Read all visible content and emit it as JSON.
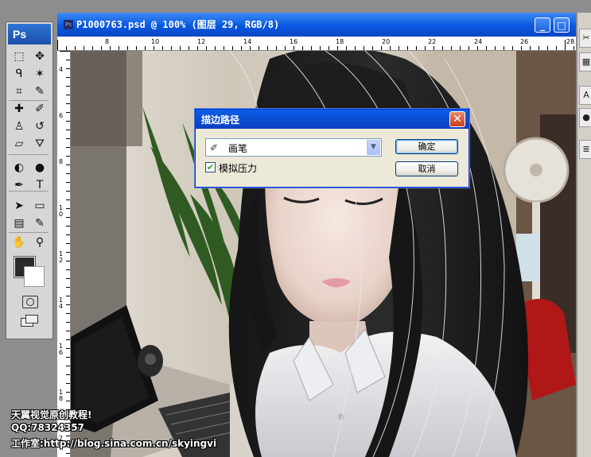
{
  "tools_palette": {
    "logo": "Ps",
    "tools": [
      {
        "name": "marquee-icon",
        "glyph": "⬚"
      },
      {
        "name": "move-icon",
        "glyph": "✥"
      },
      {
        "name": "lasso-icon",
        "glyph": "ᑫ"
      },
      {
        "name": "magic-wand-icon",
        "glyph": "✶"
      },
      {
        "name": "crop-icon",
        "glyph": "⌗"
      },
      {
        "name": "eyedropper-icon",
        "glyph": "✎"
      },
      {
        "name": "healing-brush-icon",
        "glyph": "✚"
      },
      {
        "name": "brush-icon",
        "glyph": "✐"
      },
      {
        "name": "clone-stamp-icon",
        "glyph": "♙"
      },
      {
        "name": "history-brush-icon",
        "glyph": "↺"
      },
      {
        "name": "eraser-icon",
        "glyph": "▱"
      },
      {
        "name": "paint-bucket-icon",
        "glyph": "⛛"
      },
      {
        "name": "blur-icon",
        "glyph": "◐"
      },
      {
        "name": "dodge-icon",
        "glyph": "●"
      },
      {
        "name": "pen-icon",
        "glyph": "✒"
      },
      {
        "name": "type-icon",
        "glyph": "T"
      },
      {
        "name": "path-selection-icon",
        "glyph": "➤"
      },
      {
        "name": "rectangle-shape-icon",
        "glyph": "▭"
      },
      {
        "name": "notes-icon",
        "glyph": "▤"
      },
      {
        "name": "eyedropper2-icon",
        "glyph": "✎"
      },
      {
        "name": "hand-icon",
        "glyph": "✋"
      },
      {
        "name": "zoom-icon",
        "glyph": "⚲"
      }
    ],
    "foreground_color": "#2a2a2a",
    "background_color": "#ffffff"
  },
  "document": {
    "title": "P1000763.psd @ 100% (图层 29, RGB/8)",
    "ruler_top": [
      "8",
      "10",
      "12",
      "14",
      "16",
      "18",
      "20",
      "22",
      "24",
      "26",
      "28"
    ],
    "ruler_left": [
      "4",
      "6",
      "8",
      "1\n0",
      "1\n2",
      "1\n4",
      "1\n6",
      "1\n8",
      "2"
    ],
    "window_buttons": {
      "minimize": "_",
      "maximize": "□"
    }
  },
  "dialog": {
    "title": "描边路径",
    "tool_select_value": "画笔",
    "simulate_pressure_label": "模拟压力",
    "simulate_pressure_checked": true,
    "ok_label": "确定",
    "cancel_label": "取消",
    "close_glyph": "✕"
  },
  "watermark": {
    "line1": "天翼视觉原创教程!",
    "line2": "QQ:78324357",
    "line3": "工作室:http://blog.sina.com.cn/skyingvi"
  },
  "right_panel_icons": [
    {
      "name": "tools-panel-icon",
      "glyph": "✂"
    },
    {
      "name": "navigator-panel-icon",
      "glyph": "▦"
    },
    {
      "name": "character-panel-icon",
      "glyph": "A"
    },
    {
      "name": "brush-panel-icon",
      "glyph": "●"
    },
    {
      "name": "layers-panel-icon",
      "glyph": "≣"
    }
  ]
}
